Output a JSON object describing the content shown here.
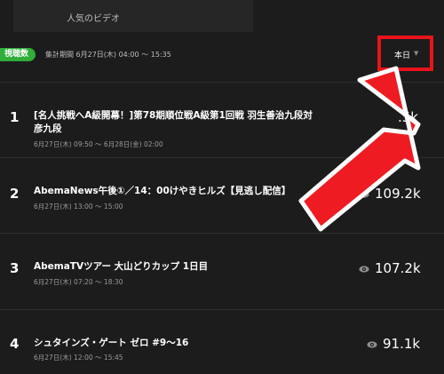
{
  "header": {
    "title": "人気のビデオ"
  },
  "filter": {
    "badge_label": "視聴数",
    "period_text": "集計期間 6月27日(木) 04:00 〜 15:35",
    "sort_label": "本日",
    "sort_caret": "▼"
  },
  "ranking": [
    {
      "rank": "1",
      "title": "[名人挑戦へA級開幕！]第78期順位戦A級第1回戦 羽生善治九段対",
      "title_line2": "彦九段",
      "time": "6月27日(木) 09:50 〜 6月28日(金) 02:00",
      "views": ".5k"
    },
    {
      "rank": "2",
      "title": "AbemaNews午後①／14：00けやきヒルズ【見逃し配信】",
      "time": "6月27日(木) 13:00 〜 15:00",
      "views": "109.2k"
    },
    {
      "rank": "3",
      "title": "AbemaTVツアー 大山どりカップ 1日目",
      "time": "6月27日(木) 07:20 〜 18:30",
      "views": "107.2k"
    },
    {
      "rank": "4",
      "title": "シュタインズ・ゲート ゼロ #9〜16",
      "time": "6月27日(木) 12:00 〜 15:45",
      "views": "91.1k"
    }
  ],
  "icons": {
    "views": "eye-icon",
    "annotation": "red-arrow"
  },
  "colors": {
    "background": "#1c1c1c",
    "badge": "#2fae39",
    "highlight": "#e8131b"
  }
}
